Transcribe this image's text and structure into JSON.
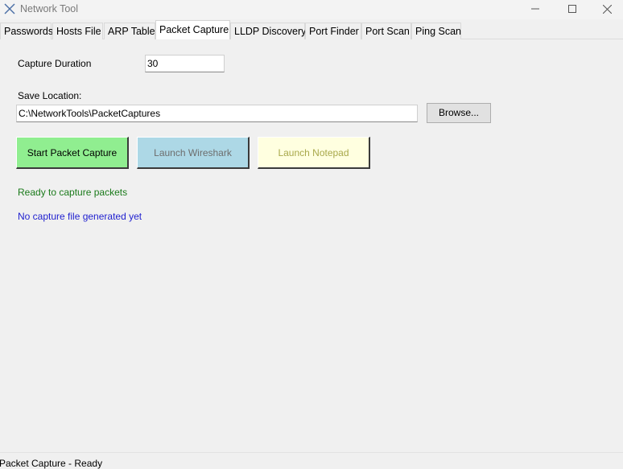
{
  "window": {
    "title": "Network Tool",
    "icon": "x-icon"
  },
  "tabs": [
    {
      "label": "Passwords",
      "active": false
    },
    {
      "label": "Hosts File",
      "active": false
    },
    {
      "label": "ARP Table",
      "active": false
    },
    {
      "label": "Packet Capture",
      "active": true
    },
    {
      "label": "LLDP Discovery",
      "active": false
    },
    {
      "label": "Port Finder",
      "active": false
    },
    {
      "label": "Port Scan",
      "active": false
    },
    {
      "label": "Ping Scan",
      "active": false
    }
  ],
  "capture": {
    "duration_label": "Capture Duration",
    "duration_value": "30",
    "save_label": "Save Location:",
    "save_value": "C:\\NetworkTools\\PacketCaptures",
    "browse_label": "Browse..."
  },
  "actions": {
    "start_label": "Start Packet Capture",
    "wireshark_label": "Launch Wireshark",
    "notepad_label": "Launch Notepad"
  },
  "status": {
    "ready_text": "Ready to capture packets",
    "file_text": "No capture file generated yet"
  },
  "statusbar": {
    "text": "Packet Capture - Ready"
  },
  "colors": {
    "start_button": "#90ee90",
    "wireshark_button": "#add8e6",
    "notepad_button": "#ffffe0",
    "status_ready": "#1a7a1a",
    "status_file": "#1f1fcf"
  }
}
